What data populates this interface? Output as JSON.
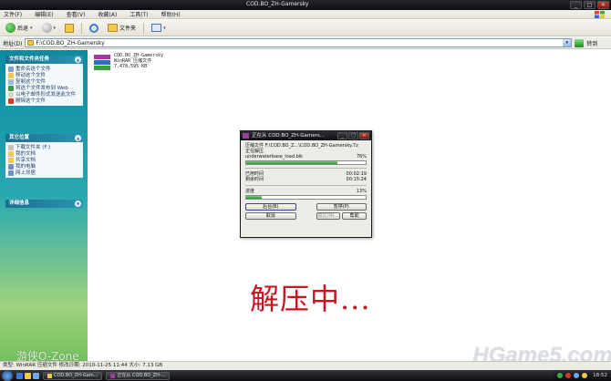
{
  "window": {
    "title": "COD.BO_ZH-Gamersky",
    "buttons": [
      "_",
      "□",
      "✕"
    ]
  },
  "menubar": [
    "文件(F)",
    "编辑(E)",
    "查看(V)",
    "收藏(A)",
    "工具(T)",
    "帮助(H)"
  ],
  "toolbar": {
    "back_label": "后退",
    "folders_label": "文件夹"
  },
  "address": {
    "label": "地址(D)",
    "path": "F:\\COD.BO_ZH-Gamersky",
    "go_label": "转到"
  },
  "sidebar": {
    "file_tasks": {
      "header": "文件和文件夹任务",
      "items": [
        {
          "label": "重命名这个文件",
          "color": "#8aa0c8"
        },
        {
          "label": "移动这个文件",
          "color": "#f0c94a"
        },
        {
          "label": "复制这个文件",
          "color": "#9bb7e0"
        },
        {
          "label": "将这个文件发布到 Web",
          "color": "#3a9d3a"
        },
        {
          "label": "以电子邮件形式发送此文件",
          "color": "#d9d6c8"
        },
        {
          "label": "删除这个文件",
          "color": "#d23a2a"
        }
      ]
    },
    "other_places": {
      "header": "其它位置",
      "items": [
        {
          "label": "下载文件夹 (F:)",
          "color": "#c7c4b7"
        },
        {
          "label": "我的文档",
          "color": "#f0c94a"
        },
        {
          "label": "共享文档",
          "color": "#f0c94a"
        },
        {
          "label": "我的电脑",
          "color": "#6e8fc8"
        },
        {
          "label": "网上邻居",
          "color": "#6e8fc8"
        }
      ]
    },
    "details": {
      "header": "详细信息"
    }
  },
  "file": {
    "name": "COD.BO_ZH-Gamersky",
    "type": "WinRAR 压缩文件",
    "size": "7,478,595 KB"
  },
  "dialog": {
    "title": "正在从 COD.BO_ZH-Gamers...",
    "archive_line": "压缩文件 F:\\COD.BO_Z...\\COD.BO_ZH-Gamersky.7z",
    "status": "正在解压",
    "current_file": "underwaterbase_load.bik",
    "file_percent": "76%",
    "file_progress": 0.76,
    "elapsed_label": "已用时间",
    "elapsed": "00:02:19",
    "remaining_label": "剩余时间",
    "remaining": "00:15:24",
    "progress_label": "进度",
    "total_percent": "13%",
    "total_progress": 0.13,
    "buttons": {
      "background": "后台(B)",
      "pause": "暂停(P)",
      "cancel": "取消",
      "mode": "模式(M)...",
      "help": "帮助"
    }
  },
  "overlay": {
    "caption": "解压中..."
  },
  "watermarks": {
    "left": "游侠O-Zone",
    "right": "HGame5.com"
  },
  "statusbar": {
    "text": "类型: WinRAR 压缩文件 修改日期: 2010-11-25 11:44 大小: 7.13 GB"
  },
  "taskbar": {
    "items": [
      {
        "label": "COD.BO_ZH-Gam...",
        "icon": "folder"
      },
      {
        "label": "正在从 COD.BO_ZH-...",
        "icon": "rar"
      }
    ],
    "clock": "18:52"
  },
  "colors": {
    "caption": "#c8141e",
    "progress": "#1f9b2b",
    "sidebar_top": "#0c8aa0",
    "sidebar_bottom": "#6dbd5a"
  }
}
